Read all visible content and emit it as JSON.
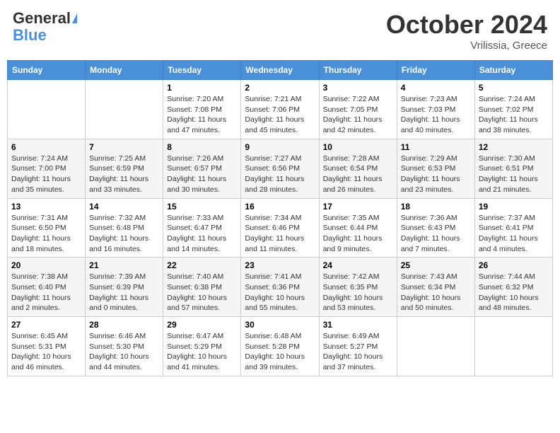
{
  "header": {
    "logo_general": "General",
    "logo_blue": "Blue",
    "title": "October 2024",
    "location": "Vrilissia, Greece"
  },
  "days_of_week": [
    "Sunday",
    "Monday",
    "Tuesday",
    "Wednesday",
    "Thursday",
    "Friday",
    "Saturday"
  ],
  "weeks": [
    [
      {
        "day": "",
        "info": ""
      },
      {
        "day": "",
        "info": ""
      },
      {
        "day": "1",
        "info": "Sunrise: 7:20 AM\nSunset: 7:08 PM\nDaylight: 11 hours and 47 minutes."
      },
      {
        "day": "2",
        "info": "Sunrise: 7:21 AM\nSunset: 7:06 PM\nDaylight: 11 hours and 45 minutes."
      },
      {
        "day": "3",
        "info": "Sunrise: 7:22 AM\nSunset: 7:05 PM\nDaylight: 11 hours and 42 minutes."
      },
      {
        "day": "4",
        "info": "Sunrise: 7:23 AM\nSunset: 7:03 PM\nDaylight: 11 hours and 40 minutes."
      },
      {
        "day": "5",
        "info": "Sunrise: 7:24 AM\nSunset: 7:02 PM\nDaylight: 11 hours and 38 minutes."
      }
    ],
    [
      {
        "day": "6",
        "info": "Sunrise: 7:24 AM\nSunset: 7:00 PM\nDaylight: 11 hours and 35 minutes."
      },
      {
        "day": "7",
        "info": "Sunrise: 7:25 AM\nSunset: 6:59 PM\nDaylight: 11 hours and 33 minutes."
      },
      {
        "day": "8",
        "info": "Sunrise: 7:26 AM\nSunset: 6:57 PM\nDaylight: 11 hours and 30 minutes."
      },
      {
        "day": "9",
        "info": "Sunrise: 7:27 AM\nSunset: 6:56 PM\nDaylight: 11 hours and 28 minutes."
      },
      {
        "day": "10",
        "info": "Sunrise: 7:28 AM\nSunset: 6:54 PM\nDaylight: 11 hours and 26 minutes."
      },
      {
        "day": "11",
        "info": "Sunrise: 7:29 AM\nSunset: 6:53 PM\nDaylight: 11 hours and 23 minutes."
      },
      {
        "day": "12",
        "info": "Sunrise: 7:30 AM\nSunset: 6:51 PM\nDaylight: 11 hours and 21 minutes."
      }
    ],
    [
      {
        "day": "13",
        "info": "Sunrise: 7:31 AM\nSunset: 6:50 PM\nDaylight: 11 hours and 18 minutes."
      },
      {
        "day": "14",
        "info": "Sunrise: 7:32 AM\nSunset: 6:48 PM\nDaylight: 11 hours and 16 minutes."
      },
      {
        "day": "15",
        "info": "Sunrise: 7:33 AM\nSunset: 6:47 PM\nDaylight: 11 hours and 14 minutes."
      },
      {
        "day": "16",
        "info": "Sunrise: 7:34 AM\nSunset: 6:46 PM\nDaylight: 11 hours and 11 minutes."
      },
      {
        "day": "17",
        "info": "Sunrise: 7:35 AM\nSunset: 6:44 PM\nDaylight: 11 hours and 9 minutes."
      },
      {
        "day": "18",
        "info": "Sunrise: 7:36 AM\nSunset: 6:43 PM\nDaylight: 11 hours and 7 minutes."
      },
      {
        "day": "19",
        "info": "Sunrise: 7:37 AM\nSunset: 6:41 PM\nDaylight: 11 hours and 4 minutes."
      }
    ],
    [
      {
        "day": "20",
        "info": "Sunrise: 7:38 AM\nSunset: 6:40 PM\nDaylight: 11 hours and 2 minutes."
      },
      {
        "day": "21",
        "info": "Sunrise: 7:39 AM\nSunset: 6:39 PM\nDaylight: 11 hours and 0 minutes."
      },
      {
        "day": "22",
        "info": "Sunrise: 7:40 AM\nSunset: 6:38 PM\nDaylight: 10 hours and 57 minutes."
      },
      {
        "day": "23",
        "info": "Sunrise: 7:41 AM\nSunset: 6:36 PM\nDaylight: 10 hours and 55 minutes."
      },
      {
        "day": "24",
        "info": "Sunrise: 7:42 AM\nSunset: 6:35 PM\nDaylight: 10 hours and 53 minutes."
      },
      {
        "day": "25",
        "info": "Sunrise: 7:43 AM\nSunset: 6:34 PM\nDaylight: 10 hours and 50 minutes."
      },
      {
        "day": "26",
        "info": "Sunrise: 7:44 AM\nSunset: 6:32 PM\nDaylight: 10 hours and 48 minutes."
      }
    ],
    [
      {
        "day": "27",
        "info": "Sunrise: 6:45 AM\nSunset: 5:31 PM\nDaylight: 10 hours and 46 minutes."
      },
      {
        "day": "28",
        "info": "Sunrise: 6:46 AM\nSunset: 5:30 PM\nDaylight: 10 hours and 44 minutes."
      },
      {
        "day": "29",
        "info": "Sunrise: 6:47 AM\nSunset: 5:29 PM\nDaylight: 10 hours and 41 minutes."
      },
      {
        "day": "30",
        "info": "Sunrise: 6:48 AM\nSunset: 5:28 PM\nDaylight: 10 hours and 39 minutes."
      },
      {
        "day": "31",
        "info": "Sunrise: 6:49 AM\nSunset: 5:27 PM\nDaylight: 10 hours and 37 minutes."
      },
      {
        "day": "",
        "info": ""
      },
      {
        "day": "",
        "info": ""
      }
    ]
  ]
}
